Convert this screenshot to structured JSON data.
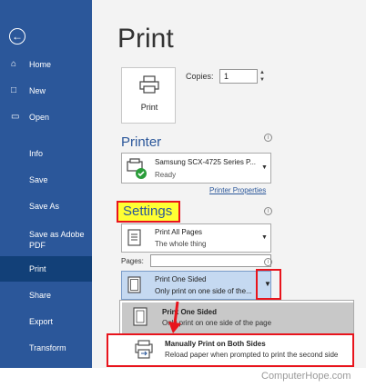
{
  "sidebar": {
    "back_icon": "back-arrow-icon",
    "items": [
      {
        "label": "Home",
        "icon": "home-icon"
      },
      {
        "label": "New",
        "icon": "new-document-icon"
      },
      {
        "label": "Open",
        "icon": "open-folder-icon"
      },
      {
        "label": "Info"
      },
      {
        "label": "Save"
      },
      {
        "label": "Save As"
      },
      {
        "label": "Save as Adobe PDF"
      },
      {
        "label": "Print",
        "active": true
      },
      {
        "label": "Share"
      },
      {
        "label": "Export"
      },
      {
        "label": "Transform"
      }
    ],
    "color": "#2b579a",
    "active_color": "#124078"
  },
  "main": {
    "title": "Print",
    "print_button_label": "Print",
    "copies_label": "Copies:",
    "copies_value": "1",
    "printer": {
      "section_title": "Printer",
      "name": "Samsung SCX-4725 Series P...",
      "status": "Ready",
      "properties_link": "Printer Properties"
    },
    "settings": {
      "section_title": "Settings",
      "print_range": {
        "title": "Print All Pages",
        "subtitle": "The whole thing"
      },
      "pages_label": "Pages:",
      "pages_value": "",
      "sided": {
        "title": "Print One Sided",
        "subtitle": "Only print on one side of the..."
      },
      "dropdown_options": [
        {
          "title": "Print One Sided",
          "subtitle": "Only print on one side of the page"
        },
        {
          "title": "Manually Print on Both Sides",
          "subtitle": "Reload paper when prompted to print the second side"
        }
      ]
    }
  },
  "highlight_color": "#e8141c",
  "watermark": "ComputerHope.com"
}
